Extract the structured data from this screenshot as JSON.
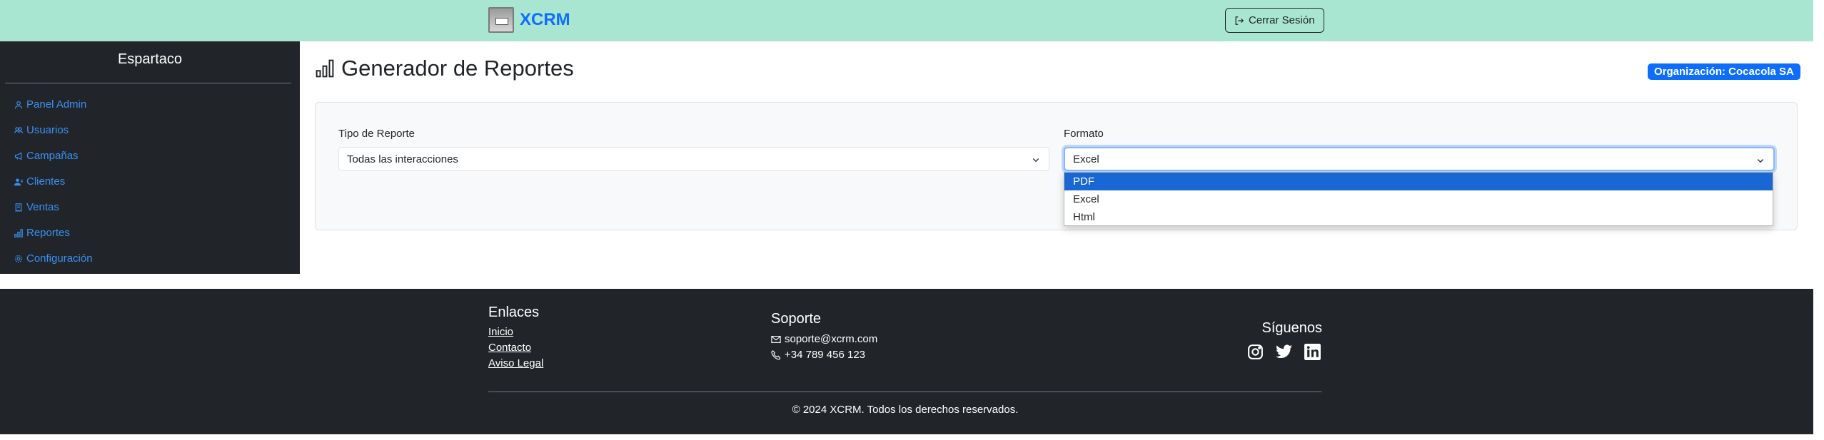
{
  "header": {
    "brand_name": "XCRM",
    "logout_label": "Cerrar Sesión"
  },
  "sidebar": {
    "user_name": "Espartaco",
    "items": [
      {
        "label": "Panel Admin",
        "icon": "person-icon"
      },
      {
        "label": "Usuarios",
        "icon": "people-icon"
      },
      {
        "label": "Campañas",
        "icon": "megaphone-icon"
      },
      {
        "label": "Clientes",
        "icon": "person-lines-icon"
      },
      {
        "label": "Ventas",
        "icon": "receipt-icon"
      },
      {
        "label": "Reportes",
        "icon": "bar-chart-icon"
      },
      {
        "label": "Configuración",
        "icon": "gear-icon"
      }
    ]
  },
  "main": {
    "title": "Generador de Reportes",
    "org_badge": "Organización: Cocacola SA",
    "report_type": {
      "label": "Tipo de Reporte",
      "value": "Todas las interacciones"
    },
    "format": {
      "label": "Formato",
      "value": "Excel",
      "options": [
        "PDF",
        "Excel",
        "Html"
      ],
      "highlighted": "PDF"
    }
  },
  "footer": {
    "links_heading": "Enlaces",
    "links": [
      "Inicio",
      "Contacto",
      "Aviso Legal"
    ],
    "support_heading": "Soporte",
    "email": "soporte@xcrm.com",
    "phone": "+34 789 456 123",
    "social_heading": "Síguenos",
    "social_icons": [
      "instagram-icon",
      "twitter-icon",
      "linkedin-icon"
    ],
    "copyright": "© 2024 XCRM. Todos los derechos reservados."
  },
  "colors": {
    "header_bg": "#a8e6d1",
    "sidebar_bg": "#212529",
    "accent": "#0d6efd",
    "footer_bg": "#212529"
  }
}
